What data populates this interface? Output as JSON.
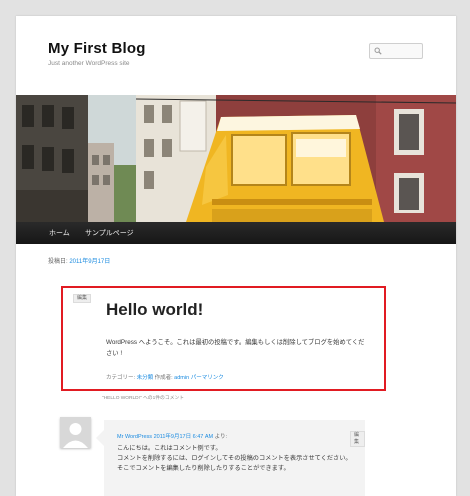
{
  "site": {
    "title": "My First Blog",
    "description": "Just another WordPress site"
  },
  "search": {
    "placeholder": ""
  },
  "nav": {
    "items": [
      "ホーム",
      "サンプルページ"
    ]
  },
  "post": {
    "posted_label": "投稿日:",
    "posted_date": "2011年9月17日",
    "edit_label": "編集",
    "title": "Hello world!",
    "body": "WordPress へようこそ。これは最初の投稿です。編集もしくは削除してブログを始めてください !",
    "category_label": "カテゴリー:",
    "category": "未分類",
    "author_label": "作成者:",
    "author": "admin",
    "permalink": "パーマリンク"
  },
  "comments": {
    "heading": "\"HELLO WORLD!\" への1件のコメント",
    "items": [
      {
        "author": "Mr WordPress",
        "date": "2011年9月17日 6:47 AM",
        "said": "より:",
        "edit_label": "編集",
        "line1": "こんにちは。これはコメント例です。",
        "line2": "コメントを削除するには、ログインしてその投稿のコメントを表示させてください。",
        "line3": "そこでコメントを編集したり削除したりすることができます。"
      }
    ]
  },
  "colors": {
    "accent_link": "#1b8be0",
    "highlight_border": "#e11b22",
    "nav_bg": "#222222"
  }
}
